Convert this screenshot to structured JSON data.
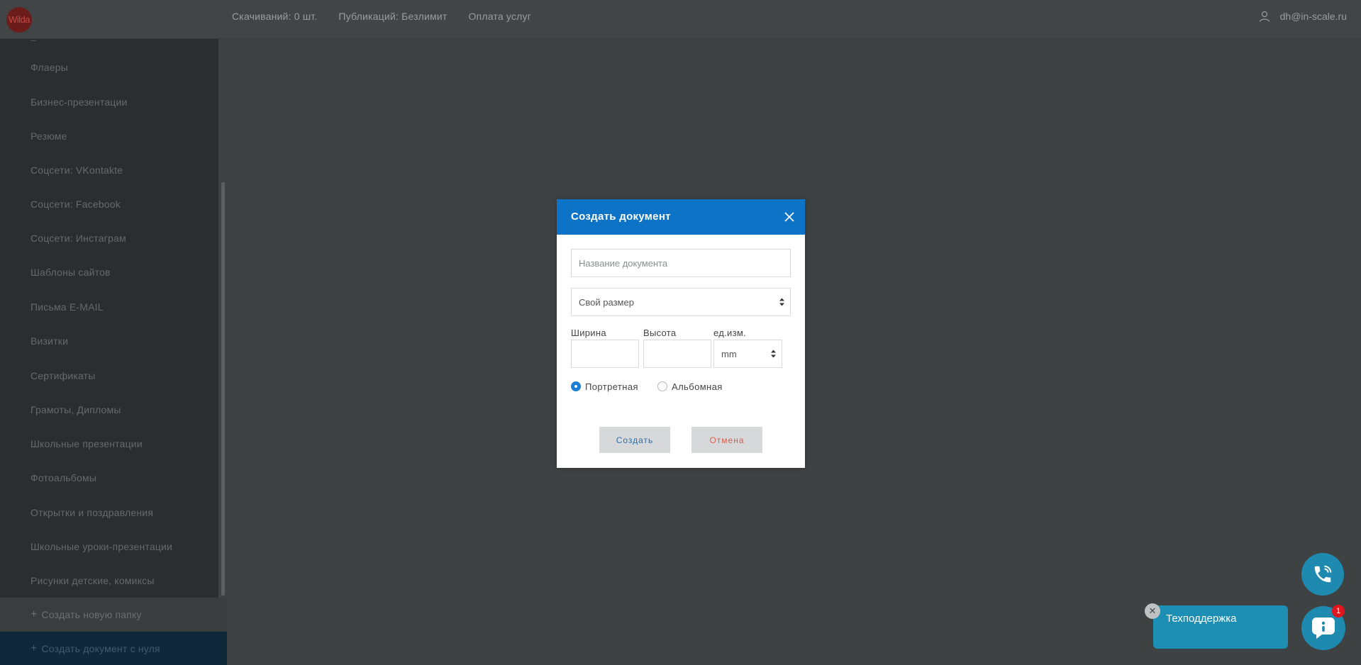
{
  "topbar": {
    "logo_text": "Wilda",
    "nav": [
      "Скачиваний: 0 шт.",
      "Публикаций: Безлимит",
      "Оплата услуг"
    ],
    "user_email": "dh@in-scale.ru"
  },
  "sidebar": {
    "items": [
      "Флаеры",
      "Бизнес-презентации",
      "Резюме",
      "Соцсети: VKontakte",
      "Соцсети: Facebook",
      "Соцсети: Инстаграм",
      "Шаблоны сайтов",
      "Письма E-MAIL",
      "Визитки",
      "Сертификаты",
      "Грамоты, Дипломы",
      "Школьные презентации",
      "Фотоальбомы",
      "Открытки и поздравления",
      "Школьные уроки-презентации",
      "Рисунки детские, комиксы"
    ],
    "new_folder": "Создать новую папку",
    "new_document": "Создать документ с нуля"
  },
  "modal": {
    "title": "Создать документ",
    "name_placeholder": "Название документа",
    "size_selected": "Свой размер",
    "width_label": "Ширина",
    "height_label": "Высота",
    "unit_label": "ед.изм.",
    "unit_selected": "mm",
    "orientation": {
      "portrait": "Портретная",
      "landscape": "Альбомная",
      "selected": "portrait"
    },
    "create_label": "Создать",
    "cancel_label": "Отмена"
  },
  "support": {
    "label": "Техподдержка",
    "close": "✕",
    "badge": "1"
  },
  "colors": {
    "accent": "#0c73c7",
    "overlay": "#3e4243",
    "support": "#1e8ab0",
    "badge": "#e0161d"
  }
}
